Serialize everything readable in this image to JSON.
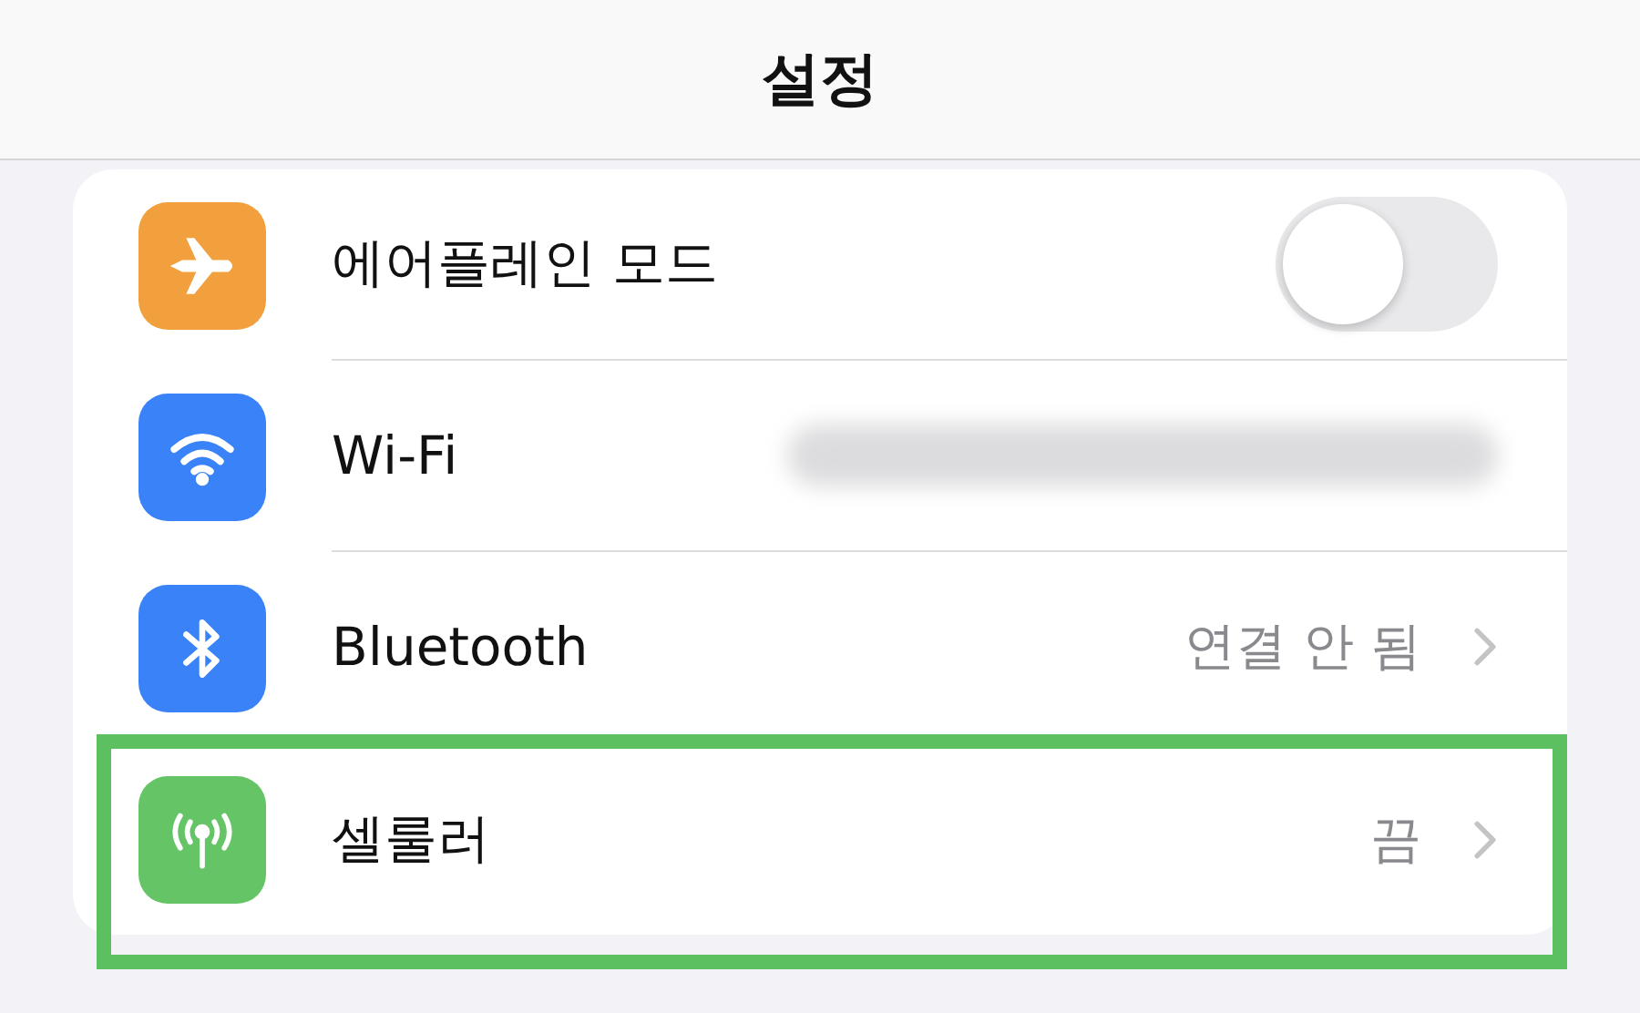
{
  "header": {
    "title": "설정"
  },
  "rows": [
    {
      "label": "에어플레인 모드",
      "color": "#f2a03d",
      "kind": "toggle",
      "on": false,
      "highlighted": false
    },
    {
      "label": "Wi-Fi",
      "color": "#3a82f7",
      "kind": "redacted",
      "highlighted": false
    },
    {
      "label": "Bluetooth",
      "color": "#3a82f7",
      "kind": "value",
      "value": "연결 안 됨",
      "highlighted": false
    },
    {
      "label": "셀룰러",
      "color": "#65c466",
      "kind": "value",
      "value": "끔",
      "highlighted": true
    }
  ]
}
